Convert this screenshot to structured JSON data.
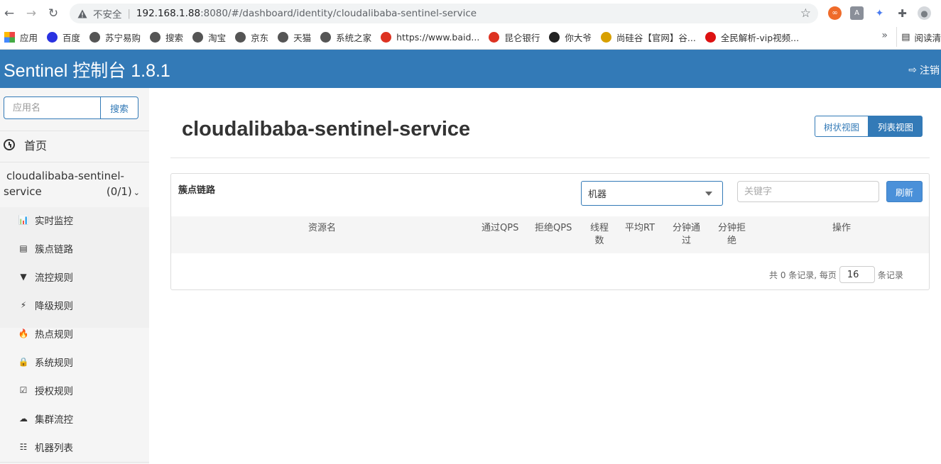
{
  "browser": {
    "insecure_label": "不安全",
    "url_host": "192.168.1.88",
    "url_rest": ":8080/#/dashboard/identity/cloudalibaba-sentinel-service",
    "bookmarks": [
      {
        "label": "应用",
        "icon": "apps-grid-icon",
        "color": "#e44"
      },
      {
        "label": "百度",
        "icon": "baidu-paw-icon",
        "color": "#2932e1"
      },
      {
        "label": "苏宁易购",
        "icon": "globe-icon",
        "color": "#555"
      },
      {
        "label": "搜索",
        "icon": "globe-icon",
        "color": "#555"
      },
      {
        "label": "淘宝",
        "icon": "globe-icon",
        "color": "#555"
      },
      {
        "label": "京东",
        "icon": "globe-icon",
        "color": "#555"
      },
      {
        "label": "天猫",
        "icon": "globe-icon",
        "color": "#555"
      },
      {
        "label": "系统之家",
        "icon": "globe-icon",
        "color": "#555"
      },
      {
        "label": "https://www.baid...",
        "icon": "petrochina-icon",
        "color": "#d32"
      },
      {
        "label": "昆仑银行",
        "icon": "petrochina-icon",
        "color": "#d32"
      },
      {
        "label": "你大爷",
        "icon": "intellij-icon",
        "color": "#222"
      },
      {
        "label": "尚硅谷【官网】谷...",
        "icon": "shangguigu-icon",
        "color": "#d8a000"
      },
      {
        "label": "全民解析-vip视频...",
        "icon": "v-icon",
        "color": "#d11"
      }
    ],
    "more_label": "»",
    "reading_label": "阅读清"
  },
  "header": {
    "brand": "Sentinel 控制台 1.8.1",
    "logout": "注销"
  },
  "sidebar": {
    "search_placeholder": "应用名",
    "search_button": "搜索",
    "home": "首页",
    "app_name_line1": "cloudalibaba-sentinel-",
    "app_name_line2": "service",
    "app_count": "(0/1)",
    "menu": [
      {
        "label": "实时监控",
        "icon": "bar-chart-icon",
        "glyph": "📊"
      },
      {
        "label": "簇点链路",
        "icon": "list-icon",
        "glyph": "▤"
      },
      {
        "label": "流控规则",
        "icon": "filter-icon",
        "glyph": "▼"
      },
      {
        "label": "降级规则",
        "icon": "flash-icon",
        "glyph": "⚡"
      },
      {
        "label": "热点规则",
        "icon": "fire-icon",
        "glyph": "🔥"
      },
      {
        "label": "系统规则",
        "icon": "lock-icon",
        "glyph": "🔒"
      },
      {
        "label": "授权规则",
        "icon": "check-square-icon",
        "glyph": "☑"
      },
      {
        "label": "集群流控",
        "icon": "cloud-icon",
        "glyph": "☁"
      },
      {
        "label": "机器列表",
        "icon": "th-list-icon",
        "glyph": "☷"
      }
    ]
  },
  "main": {
    "title": "cloudalibaba-sentinel-service",
    "tree_view": "树状视图",
    "list_view": "列表视图",
    "panel_title": "簇点链路",
    "machine_select": "机器",
    "keyword_placeholder": "关键字",
    "refresh": "刷新",
    "columns": {
      "resource": "资源名",
      "pass_qps": "通过QPS",
      "block_qps": "拒绝QPS",
      "threads_1": "线程",
      "threads_2": "数",
      "avg_rt": "平均RT",
      "min_pass_1": "分钟通",
      "min_pass_2": "过",
      "min_block_1": "分钟拒",
      "min_block_2": "绝",
      "ops": "操作"
    },
    "footer_prefix": "共 0 条记录, 每页",
    "page_size": "16",
    "footer_suffix": "条记录"
  },
  "colors": {
    "primary": "#337ab7",
    "refresh_button": "#4a90d9"
  }
}
